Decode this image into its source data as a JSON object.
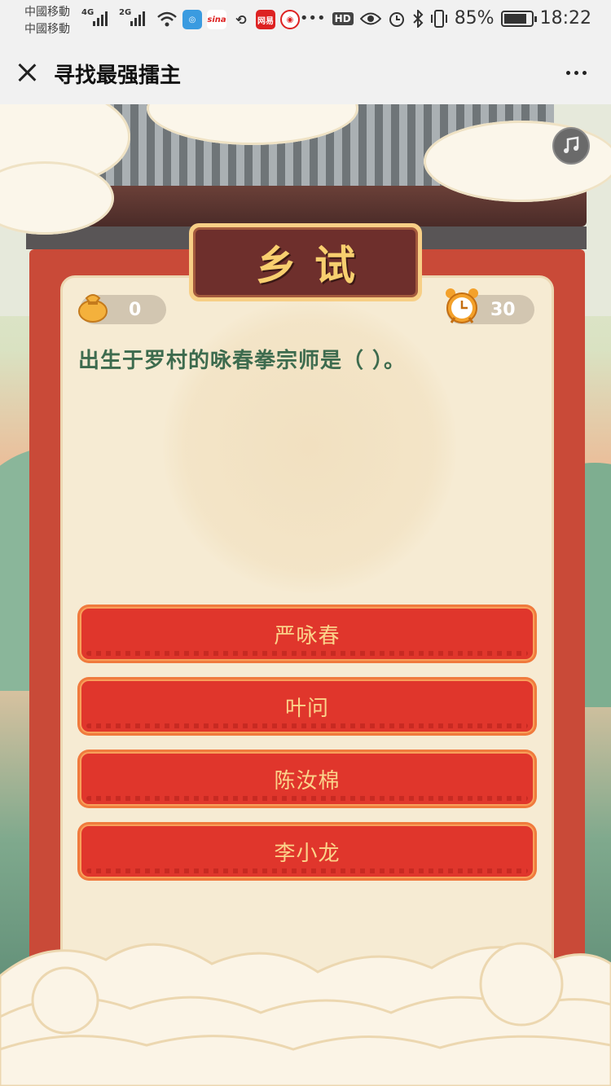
{
  "status_bar": {
    "carrier_1": "中國移動",
    "carrier_2": "中國移動",
    "network_1": "4G",
    "network_2": "2G",
    "hd_label": "HD",
    "battery_percent": "85%",
    "battery_level": 0.85,
    "time": "18:22",
    "icons": [
      "signal-icon",
      "wifi-icon",
      "app-notification-icon",
      "sina-icon",
      "sync-icon",
      "netease-icon",
      "weibo-icon",
      "more-dots-icon",
      "eye-icon",
      "alarm-icon",
      "bluetooth-icon",
      "vibrate-icon",
      "battery-icon"
    ]
  },
  "nav": {
    "title": "寻找最强擂主",
    "close_icon": "close-icon",
    "more_icon": "more-icon"
  },
  "game": {
    "stage_title": "乡试",
    "coins": "0",
    "timer": "30",
    "question": "出生于罗村的咏春拳宗师是（ ）。",
    "options": [
      "严咏春",
      "叶问",
      "陈汝棉",
      "李小龙"
    ],
    "sound_icon": "music-icon"
  },
  "colors": {
    "option_bg": "#e0362c",
    "option_text": "#fbd38a",
    "question_text": "#3d6b4e",
    "board": "#c94a38",
    "panel": "#f6ebd3"
  }
}
